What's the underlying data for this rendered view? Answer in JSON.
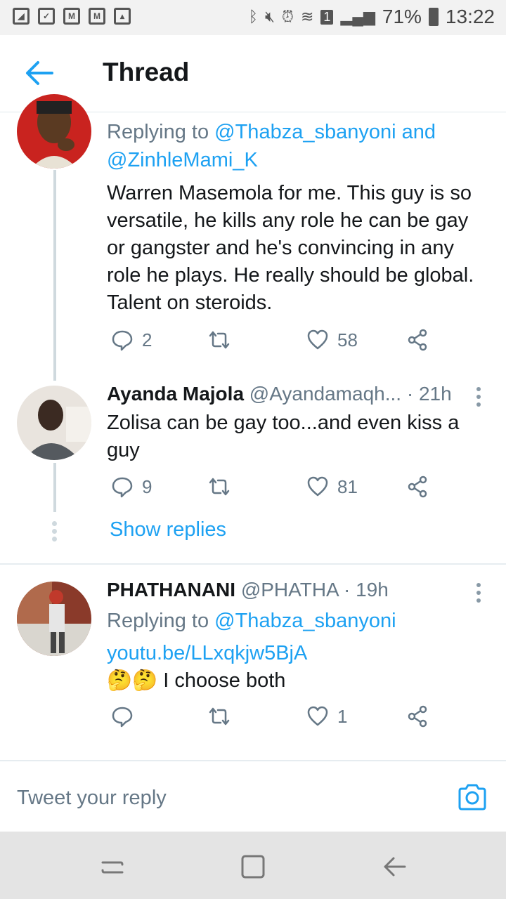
{
  "status_bar": {
    "battery": "71%",
    "time": "13:22",
    "notification_icons": [
      "android-icon",
      "checkbox-icon",
      "mail-icon",
      "mail-icon",
      "image-icon"
    ],
    "system_icons": [
      "bluetooth-icon",
      "mute-icon",
      "alarm-icon",
      "wifi-icon",
      "signal-icon"
    ],
    "sim_label": "1"
  },
  "header": {
    "title": "Thread",
    "back_icon": "back-arrow-icon"
  },
  "tweets": [
    {
      "reply_prefix": "Replying to",
      "reply_mention_1": "@Thabza_sbanyoni",
      "reply_and": "and",
      "reply_mention_2": "@ZinhleMami_K",
      "text": "Warren Masemola for me. This guy is so versatile, he kills any role he can be gay or gangster and he's convincing in any role he plays.  He really should be global. Talent on steroids.",
      "replies": "2",
      "likes": "58"
    },
    {
      "name": "Ayanda Majola",
      "handle": "@Ayandamaqh...",
      "time": "· 21h",
      "text": "Zolisa can be gay too...and even kiss a guy",
      "replies": "9",
      "likes": "81"
    },
    {
      "name": "PHATHANANI",
      "handle": "@PHATHA",
      "time": "· 19h",
      "reply_prefix": "Replying to",
      "reply_mention_1": "@Thabza_sbanyoni",
      "link": "youtu.be/LLxqkjw5BjA",
      "emoji": "🤔🤔",
      "text": "I choose both",
      "replies": "",
      "likes": "1"
    }
  ],
  "show_replies": "Show replies",
  "composer": {
    "placeholder": "Tweet your reply",
    "camera_icon": "camera-icon"
  },
  "nav_bar": {
    "icons": [
      "recent-apps-icon",
      "home-icon",
      "back-icon"
    ]
  },
  "colors": {
    "accent": "#1da1f2",
    "secondary_text": "#657786",
    "thread_line": "#cfd9de"
  }
}
